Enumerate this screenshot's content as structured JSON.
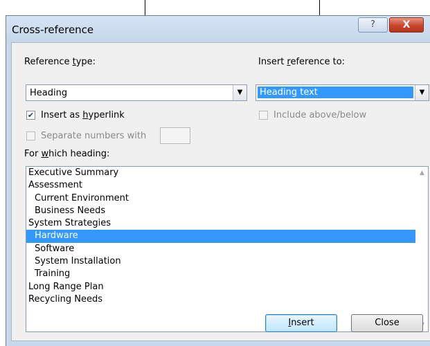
{
  "dialog": {
    "title": "Cross-reference",
    "help_glyph": "?",
    "close_glyph": "X"
  },
  "reference_type": {
    "label_pre": "Reference ",
    "label_key": "t",
    "label_post": "ype:",
    "value": "Heading"
  },
  "insert_reference_to": {
    "label_pre": "Insert ",
    "label_key": "r",
    "label_post": "eference to:",
    "value": "Heading text"
  },
  "insert_as_hyperlink": {
    "label_pre": "Insert as ",
    "label_key": "h",
    "label_post": "yperlink",
    "checked": true
  },
  "include_above_below": {
    "label": "Include above/below",
    "checked": false,
    "enabled": false
  },
  "separate_numbers": {
    "label": "Separate numbers with",
    "checked": false,
    "enabled": false
  },
  "for_which": {
    "label_pre": "For ",
    "label_key": "w",
    "label_post": "hich heading:"
  },
  "headings": [
    {
      "text": "Executive Summary",
      "level": 1,
      "selected": false
    },
    {
      "text": "Assessment",
      "level": 1,
      "selected": false
    },
    {
      "text": "Current Environment",
      "level": 2,
      "selected": false
    },
    {
      "text": "Business Needs",
      "level": 2,
      "selected": false
    },
    {
      "text": "System Strategies",
      "level": 1,
      "selected": false
    },
    {
      "text": "Hardware",
      "level": 2,
      "selected": true
    },
    {
      "text": "Software",
      "level": 2,
      "selected": false
    },
    {
      "text": "System Installation",
      "level": 2,
      "selected": false
    },
    {
      "text": "Training",
      "level": 2,
      "selected": false
    },
    {
      "text": "Long Range Plan",
      "level": 1,
      "selected": false
    },
    {
      "text": "Recycling Needs",
      "level": 1,
      "selected": false
    }
  ],
  "buttons": {
    "insert_key": "I",
    "insert_rest": "nsert",
    "close": "Close"
  },
  "icons": {
    "combo_arrow": "chevron-down-icon",
    "checkmark": "checkmark-icon"
  }
}
